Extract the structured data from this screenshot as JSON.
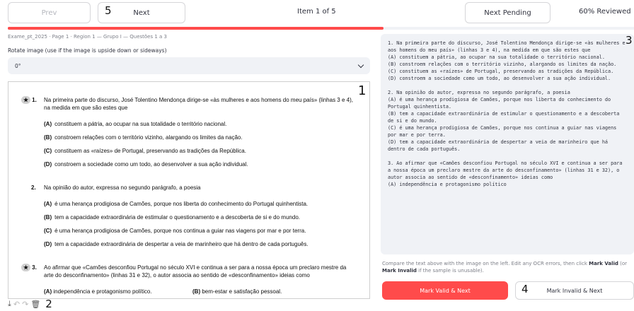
{
  "header": {
    "prev_label": "Prev",
    "next_label": "Next",
    "item_counter": "Item 1 of 5",
    "next_pending_label": "Next Pending",
    "reviewed": "60% Reviewed",
    "reviewed_fraction": 0.6
  },
  "annotations": {
    "n1": "1",
    "n2": "2",
    "n3": "3",
    "n4": "4",
    "n5": "5"
  },
  "left": {
    "caption": "Exame_pt_2025 · Page 1 · Region 1 — Grupo I — Questões 1 a 3",
    "rotate_label": "Rotate image (use if the image is upside down or sideways)",
    "rotate_value": "0°"
  },
  "doc": {
    "q1_num": "1.",
    "q1_text": "Na primeira parte do discurso, José Tolentino Mendonça dirige-se «às mulheres e aos homens do meu país» (linhas 3 e 4), na medida em que são estes que",
    "q1_a": "constituem a pátria, ao ocupar na sua totalidade o território nacional.",
    "q1_b": "constroem relações com o território vizinho, alargando os limites da nação.",
    "q1_c": "constituem as «raízes» de Portugal, preservando as tradições da República.",
    "q1_d": "constroem a sociedade como um todo, ao desenvolver a sua ação individual.",
    "q2_num": "2.",
    "q2_text": "Na opinião do autor, expressa no segundo parágrafo, a poesia",
    "q2_a": "é uma herança prodigiosa de Camões, porque nos liberta do conhecimento do Portugal quinhentista.",
    "q2_b": "tem a capacidade extraordinária de estimular o questionamento e a descoberta de si e do mundo.",
    "q2_c": "é uma herança prodigiosa de Camões, porque nos continua a guiar nas viagens por mar e por terra.",
    "q2_d": "tem a capacidade extraordinária de despertar a veia de marinheiro que há dentro de cada português.",
    "q3_num": "3.",
    "q3_text": "Ao afirmar que «Camões desconfiou Portugal no século XVI e continua a ser para a nossa época um preclaro mestre da arte do desconfinamento» (linhas 31 e 32), o autor associa ao sentido de «desconfinamento» ideias como",
    "q3_a": "independência e protagonismo político.",
    "q3_b": "bem-estar e satisfação pessoal.",
    "star": "★",
    "label_a": "(A)",
    "label_b": "(B)",
    "label_c": "(C)",
    "label_d": "(D)"
  },
  "ocr_text": "1. Na primeira parte do discurso, José Tolentino Mendonça dirige-se «às mulheres e aos homens do meu país» (linhas 3 e 4), na medida em que são estes que\n(A) constituem a pátria, ao ocupar na sua totalidade o território nacional.\n(B) constroem relações com o território vizinho, alargando os limites da nação.\n(C) constituem as «raízes» de Portugal, preservando as tradições da República.\n(D) constroem a sociedade como um todo, ao desenvolver a sua ação individual.\n\n2. Na opinião do autor, expressa no segundo parágrafo, a poesia\n(A) é uma herança prodigiosa de Camões, porque nos liberta do conhecimento do Portugal quinhentista.\n(B) tem a capacidade extraordinária de estimular o questionamento e a descoberta de si e do mundo.\n(C) é uma herança prodigiosa de Camões, porque nos continua a guiar nas viagens por mar e por terra.\n(D) tem a capacidade extraordinária de despertar a veia de marinheiro que há dentro de cada português.\n\n3. Ao afirmar que «Camões desconfiou Portugal no século XVI e continua a ser para a nossa época um preclaro mestre da arte do desconfinamento» (linhas 31 e 32), o autor associa ao sentido de «desconfinamento» ideias como\n(A) independência e protagonismo político",
  "help": {
    "text_before": "Compare the text above with the image on the left. Edit any OCR errors, then click ",
    "valid_word": "Mark Valid",
    "text_mid": " (or ",
    "invalid_word": "Mark Invalid",
    "text_after": " if the sample is unusable)."
  },
  "actions": {
    "mark_valid": "Mark Valid & Next",
    "mark_invalid": "Mark Invalid & Next"
  },
  "tools": {
    "download_icon": "⤓",
    "undo_icon": "↶",
    "redo_icon": "↷",
    "delete_icon": "🗑"
  },
  "colors": {
    "accent": "#ff4b4b",
    "panel": "#f0f2f6"
  }
}
